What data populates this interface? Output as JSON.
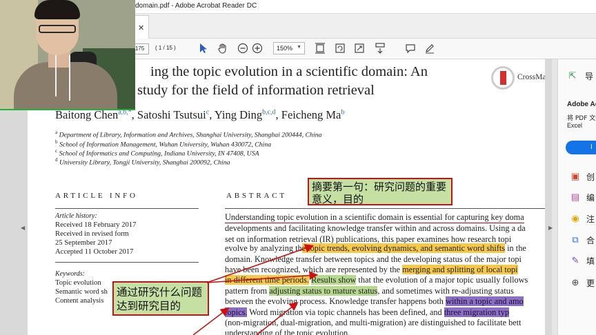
{
  "window": {
    "title": "ic domain.pdf - Adobe Acrobat Reader DC",
    "tab_close": "✕"
  },
  "toolbar": {
    "page_input": "1175",
    "page_count": "( 1 / 15 )",
    "zoom": "150%",
    "icons": [
      "select-arrow-icon",
      "hand-icon",
      "zoom-out-icon",
      "zoom-in-icon",
      "crop-icon",
      "rotate-icon",
      "fit-page-icon",
      "scroll-mode-icon",
      "comment-icon",
      "pen-icon"
    ]
  },
  "paper": {
    "title_line1": "ing the topic evolution in a scientific domain: An",
    "title_line2": "study for the field of information retrieval",
    "crossmark": "CrossMa",
    "authors": [
      {
        "name": "Baitong Chen",
        "sup": "a,b,*"
      },
      {
        "name": "Satoshi Tsutsui",
        "sup": "c"
      },
      {
        "name": "Ying Ding",
        "sup": "b,c,d"
      },
      {
        "name": "Feicheng Ma",
        "sup": "b"
      }
    ],
    "affiliations": [
      {
        "sup": "a",
        "text": "Department of Library, Information and Archives, Shanghai University, Shanghai 200444, China"
      },
      {
        "sup": "b",
        "text": "School of Information Management, Wuhan University, Wuhan 430072, China"
      },
      {
        "sup": "c",
        "text": "School of Informatics and Computing, Indiana University, IN 47408, USA"
      },
      {
        "sup": "d",
        "text": "University Library, Tongji University, Shanghai 200092, China"
      }
    ],
    "article_info_heading": "ARTICLE INFO",
    "abstract_heading": "ABSTRACT",
    "article_history_label": "Article history:",
    "history": [
      "Received 18 February 2017",
      "Received in revised form",
      "25 September 2017",
      "Accepted 11 October 2017"
    ],
    "keywords_label": "Keywords:",
    "keywords": [
      "Topic evolution",
      "Semantic word sh",
      "Content analysis"
    ],
    "abstract_lines": [
      {
        "pre": "Understanding topic evolution in a scientific domain is essential for capturing key doma",
        "hl": "",
        "post": ""
      },
      {
        "pre": "developments and facilitating knowledge transfer within and across domains. Using a da",
        "hl": "",
        "post": ""
      },
      {
        "pre": "set on information retrieval (IR) publications, this paper examines how research topi",
        "hl": "",
        "post": ""
      },
      {
        "pre": "evolve by analyzing th",
        "hl": "e topic trends, evolving dynamics, and semantic word shifts",
        "post": " in the"
      },
      {
        "pre": "domain. Knowledge transfer between topics and the developing status of the major topi",
        "hl": "",
        "post": ""
      },
      {
        "pre": "have been recognized, which are represented by the ",
        "hl": "merging and splitting of local topi",
        "post": ""
      },
      {
        "pre": "",
        "hl": "in different time periods.",
        "post": " "
      },
      {
        "pre": "pattern from ",
        "hl": "adjusting status to mature status",
        "post": ", and sometimes with re-adjusting status"
      },
      {
        "pre": "between the evolving process. Knowledge transfer happens both ",
        "hl": "within a topic and amo",
        "post": ""
      },
      {
        "pre": "",
        "hl": "topics.",
        "post": " Word migration via topic channels has been defined, and "
      },
      {
        "pre": "(non-migration, dual-migration, and multi-migration) are distinguished to facilitate bett",
        "hl": "",
        "post": ""
      },
      {
        "pre": "understanding of the topic evolution.",
        "hl": "",
        "post": ""
      }
    ],
    "abstract_line6_extra_hl": "Results show",
    "abstract_line6_post": " that the evolution of a major topic usually follows",
    "abstract_line9_hl2": "three migration typ"
  },
  "annotations": {
    "note1": "摘要第一句：研究问题的重要意义，目的",
    "note2": "通过研究什么问题达到研究目的"
  },
  "right_panel": {
    "export_label": "导",
    "account_title": "Adobe Ac",
    "account_desc_1": "将 PDF 文件",
    "account_desc_2": "Excel",
    "button_label": "I",
    "items": [
      {
        "icon": "create-pdf-icon",
        "label": "创"
      },
      {
        "icon": "edit-pdf-icon",
        "label": "编"
      },
      {
        "icon": "comment-icon",
        "label": "注"
      },
      {
        "icon": "combine-icon",
        "label": "合"
      },
      {
        "icon": "fill-sign-icon",
        "label": "填"
      },
      {
        "icon": "more-tools-icon",
        "label": "更"
      }
    ]
  },
  "colors": {
    "highlight_orange": "#f7c94a",
    "highlight_green": "#b7d98d",
    "highlight_purple": "#8b6fc5",
    "annotation_border": "#c01515",
    "annotation_fill": "#c6e0a4",
    "accent_blue": "#1473e6"
  }
}
